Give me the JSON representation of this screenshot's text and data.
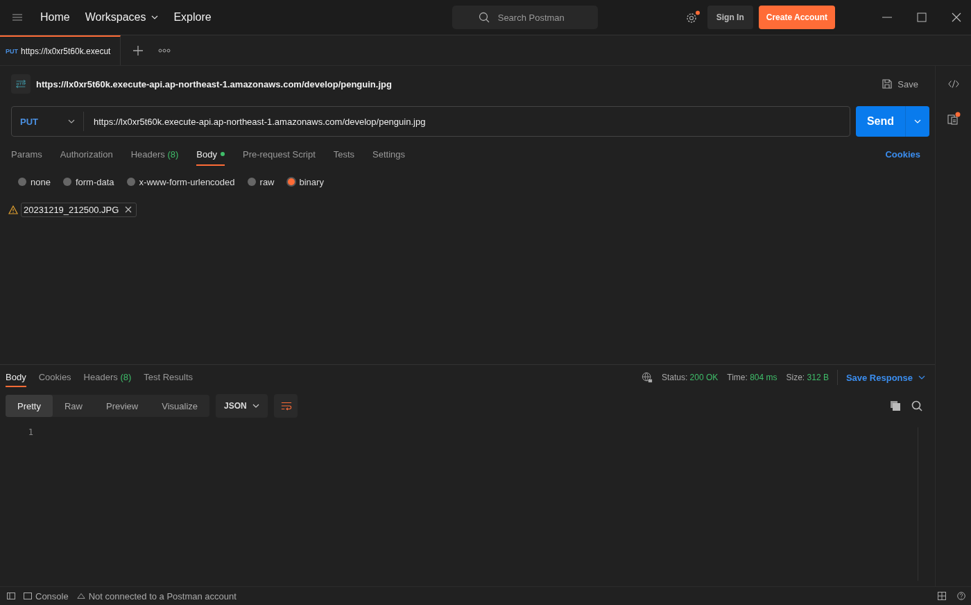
{
  "nav": {
    "items": [
      {
        "label": "Home",
        "dropdown": false
      },
      {
        "label": "Workspaces",
        "dropdown": true
      },
      {
        "label": "Explore",
        "dropdown": false
      }
    ],
    "search": {
      "placeholder": "Search Postman"
    },
    "sign_in": "Sign In",
    "create_account": "Create Account"
  },
  "tab": {
    "method": "PUT",
    "title": "https://lx0xr5t60k.execut",
    "selected": true
  },
  "request": {
    "title": "https://lx0xr5t60k.execute-api.ap-northeast-1.amazonaws.com/develop/penguin.jpg",
    "save": "Save",
    "method": "PUT",
    "url": "https://lx0xr5t60k.execute-api.ap-northeast-1.amazonaws.com/develop/penguin.jpg",
    "send": "Send"
  },
  "request_tabs": [
    {
      "label": "Params",
      "modified": false,
      "selected": false
    },
    {
      "label": "Authorization",
      "modified": false,
      "selected": false
    },
    {
      "label": "Headers",
      "count": "(8)",
      "modified": false,
      "selected": false
    },
    {
      "label": "Body",
      "modified": true,
      "selected": true
    },
    {
      "label": "Pre-request Script",
      "modified": false,
      "selected": false
    },
    {
      "label": "Tests",
      "modified": false,
      "selected": false
    },
    {
      "label": "Settings",
      "modified": false,
      "selected": false
    }
  ],
  "cookies": "Cookies",
  "body_types": [
    {
      "label": "none",
      "selected": false
    },
    {
      "label": "form-data",
      "selected": false
    },
    {
      "label": "x-www-form-urlencoded",
      "selected": false
    },
    {
      "label": "raw",
      "selected": false
    },
    {
      "label": "binary",
      "selected": true
    }
  ],
  "file": {
    "name": "20231219_212500.JPG",
    "warning": true
  },
  "response_tabs": [
    {
      "label": "Body",
      "selected": true
    },
    {
      "label": "Cookies",
      "selected": false
    },
    {
      "label": "Headers",
      "count": "(8)",
      "selected": false
    },
    {
      "label": "Test Results",
      "selected": false
    }
  ],
  "response_stats": [
    {
      "label": "Status:",
      "value": "200 OK"
    },
    {
      "label": "Time:",
      "value": "804 ms"
    },
    {
      "label": "Size:",
      "value": "312 B"
    }
  ],
  "save_response": "Save Response",
  "view_modes": [
    {
      "label": "Pretty",
      "selected": true
    },
    {
      "label": "Raw",
      "selected": false
    },
    {
      "label": "Preview",
      "selected": false
    },
    {
      "label": "Visualize",
      "selected": false
    }
  ],
  "format": "JSON",
  "line_numbers": [
    "1"
  ],
  "status_bar": {
    "console": "Console",
    "connection": "Not connected to a Postman account"
  }
}
